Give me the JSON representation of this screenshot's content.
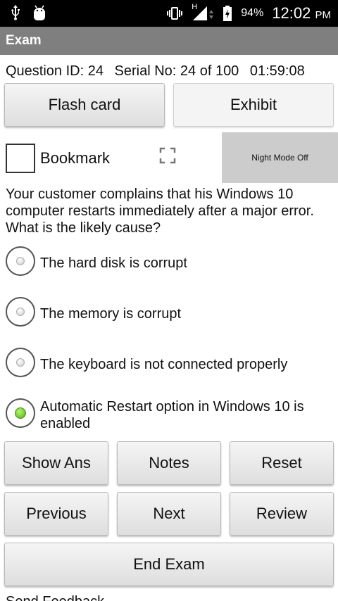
{
  "status_bar": {
    "icons": [
      "usb-icon",
      "android-debug-icon",
      "vibrate-icon",
      "signal-icon",
      "battery-charging-icon"
    ],
    "network_type": "H",
    "battery": "94%",
    "time": "12:02",
    "ampm": "PM"
  },
  "app": {
    "title": "Exam"
  },
  "info": {
    "question_id": "Question ID: 24",
    "serial": "Serial No: 24 of 100",
    "timer": "01:59:08"
  },
  "top_buttons": {
    "flash_card": "Flash card",
    "exhibit": "Exhibit"
  },
  "bookmark": {
    "label": "Bookmark",
    "checked": false
  },
  "night_mode": {
    "label": "Night Mode Off"
  },
  "question": {
    "text": "Your customer complains that his Windows 10 computer restarts immediately after a major error. What is the likely cause?"
  },
  "options": [
    {
      "text": "The hard disk is corrupt",
      "selected": false
    },
    {
      "text": "The memory is corrupt",
      "selected": false
    },
    {
      "text": "The keyboard is not connected properly",
      "selected": false
    },
    {
      "text": "Automatic Restart option in Windows 10 is enabled",
      "selected": true
    }
  ],
  "actions": {
    "show_ans": "Show Ans",
    "notes": "Notes",
    "reset": "Reset",
    "previous": "Previous",
    "next": "Next",
    "review": "Review",
    "end_exam": "End Exam"
  },
  "footer": {
    "send_feedback": "Send Feedback"
  },
  "colors": {
    "title_bar": "#7f7f7f",
    "selected_radio": "#4caf1a",
    "night_mode_bg": "#cccccc"
  }
}
